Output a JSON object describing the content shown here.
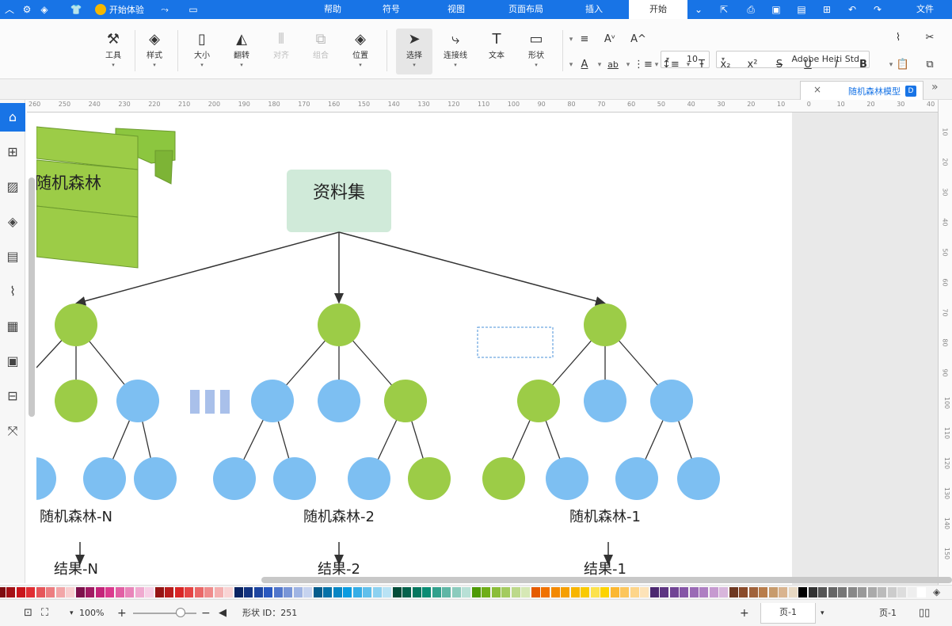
{
  "menubar": {
    "tabs": [
      {
        "label": "文件",
        "active": false
      },
      {
        "label": "开始",
        "active": true
      },
      {
        "label": "插入",
        "active": false
      },
      {
        "label": "页面布局",
        "active": false
      },
      {
        "label": "视图",
        "active": false
      },
      {
        "label": "符号",
        "active": false
      },
      {
        "label": "帮助",
        "active": false
      }
    ],
    "vip_label": "开始体验",
    "quick_icons": [
      "undo-icon",
      "redo-icon",
      "new-page-icon",
      "open-folder-icon",
      "save-icon",
      "print-icon",
      "export-icon",
      "more-icon"
    ],
    "right_icons": [
      "feedback-icon",
      "share-icon",
      "shirt-icon",
      "settings-icon",
      "collapse-icon"
    ]
  },
  "ribbon": {
    "tools": [
      {
        "label": "工具",
        "icon": "tool-icon"
      },
      {
        "label": "样式",
        "icon": "paint-bucket-icon"
      },
      {
        "label": "大小",
        "icon": "size-icon"
      },
      {
        "label": "翻转",
        "icon": "flip-icon"
      },
      {
        "label": "对齐",
        "icon": "align-icon",
        "disabled": true
      },
      {
        "label": "组合",
        "icon": "group-icon",
        "disabled": true
      },
      {
        "label": "位置",
        "icon": "layers-icon"
      },
      {
        "label": "选择",
        "icon": "select-arrow-icon",
        "active": true
      },
      {
        "label": "连接线",
        "icon": "connector-icon"
      },
      {
        "label": "文本",
        "icon": "text-icon"
      },
      {
        "label": "形状",
        "icon": "shape-icon"
      }
    ],
    "font_name": "Adobe Heiti Std",
    "font_size": "10"
  },
  "doc_tab": {
    "title": "随机森林模型"
  },
  "sidebar": {
    "icons": [
      "format-painter-icon",
      "grid-icon",
      "image-icon",
      "layers-icon",
      "page-icon",
      "chart-icon",
      "table-icon",
      "map-icon",
      "outline-icon",
      "fit-icon"
    ]
  },
  "ruler": {
    "h_labels": [
      "260",
      "250",
      "240",
      "230",
      "220",
      "210",
      "200",
      "190",
      "180",
      "170",
      "160",
      "150",
      "140",
      "130",
      "120",
      "110",
      "100",
      "90",
      "80",
      "70",
      "60",
      "50",
      "40",
      "30",
      "20",
      "10",
      "0",
      "10",
      "20",
      "30",
      "40",
      "50"
    ],
    "v_labels": [
      "10",
      "20",
      "30",
      "40",
      "50",
      "60",
      "70",
      "80",
      "90",
      "100",
      "110",
      "120",
      "130",
      "140",
      "150"
    ]
  },
  "diagram": {
    "banner_text": "随机森林",
    "root_label": "资料集",
    "tree_labels": [
      "随机森林-N",
      "随机森林-2",
      "随机森林-1"
    ],
    "result_labels": [
      "结果-N",
      "结果-2",
      "结果-1"
    ],
    "colors": {
      "green": "#9ccc47",
      "blue": "#7dbff2",
      "root_fill": "#d0ead9",
      "banner": "#8cc63f",
      "ellipsis": "#a9c0ea"
    }
  },
  "palette": {
    "colors": [
      "#ffffff",
      "#eeeeee",
      "#dddddd",
      "#cccccc",
      "#bbbbbb",
      "#aaaaaa",
      "#999999",
      "#888888",
      "#777777",
      "#666666",
      "#555555",
      "#333333",
      "#000000",
      "#e8d9c3",
      "#d9b48f",
      "#c79b6c",
      "#b87d4b",
      "#a0623a",
      "#8a4b2a",
      "#6e3821",
      "#d8b6dc",
      "#c69ad0",
      "#ae7fc2",
      "#9a6ab5",
      "#8555a6",
      "#714494",
      "#5e3582",
      "#4c2870",
      "#fde3b8",
      "#fdd58a",
      "#fcc65c",
      "#fbb730",
      "#fdd300",
      "#fce24d",
      "#f9ca00",
      "#f7b500",
      "#f59f00",
      "#f38900",
      "#f07200",
      "#e55b00",
      "#d6e8b5",
      "#bcd98a",
      "#a3cb5f",
      "#8abd38",
      "#6fae18",
      "#4e9a06",
      "#b8e0d6",
      "#8bcbbd",
      "#5fb6a5",
      "#32a18d",
      "#0a8c74",
      "#07775f",
      "#05624c",
      "#034d3a",
      "#b9e3f5",
      "#8dd1f0",
      "#61bfeb",
      "#35ade6",
      "#0a9be0",
      "#0886c4",
      "#0671a8",
      "#055c8c",
      "#c6d3ef",
      "#9fb4e3",
      "#7895d7",
      "#5176cb",
      "#2a58bf",
      "#1e45a0",
      "#143481",
      "#0b2462",
      "#f9d4d4",
      "#f4b0b0",
      "#ef8c8c",
      "#ea6868",
      "#e54545",
      "#d92626",
      "#b81d1d",
      "#961515",
      "#f7d0e6",
      "#f0aad0",
      "#e985ba",
      "#e25fa4",
      "#db3a8e",
      "#c4247a",
      "#a11a63",
      "#7e114c",
      "#f8cfd0",
      "#f2a6a8",
      "#ec7e81",
      "#e6565a",
      "#e02e33",
      "#c9151b",
      "#a41116",
      "#7f0d11"
    ]
  },
  "statusbar": {
    "page_name": "页-1",
    "page_tab": "页-1",
    "shape_id": "形状 ID：251",
    "zoom": "100%"
  }
}
